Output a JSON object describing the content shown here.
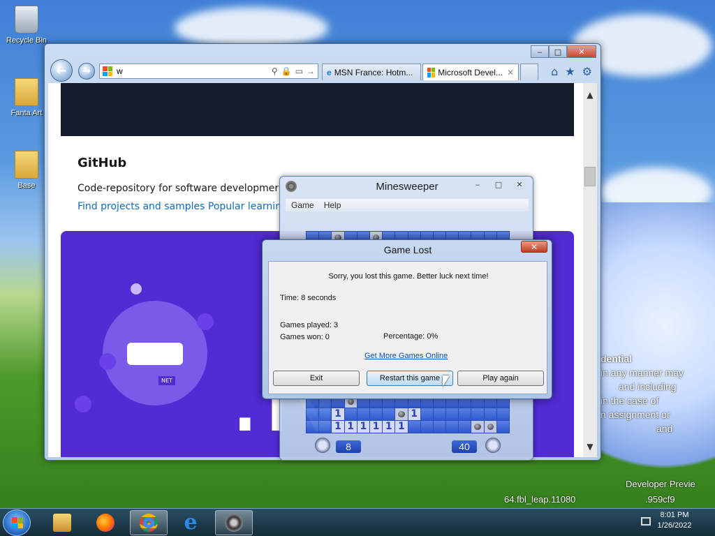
{
  "desktop": {
    "icons": [
      {
        "label": "Recycle Bin"
      },
      {
        "label": "Fanta Art"
      },
      {
        "label": "Base"
      }
    ],
    "wallpaper_text": {
      "line1": "dential",
      "line2": "in any manner may",
      "line3": "and including",
      "line4": "in the case of",
      "line5": "n assignment or",
      "line6": "and",
      "build_line1": "Developer Previe",
      "build_line2": "64.fbl_leap.11080",
      "build_line3": ".959cf9"
    }
  },
  "browser": {
    "address": "w",
    "tabs": [
      {
        "label": "MSN France: Hotm..."
      },
      {
        "label": "Microsoft Devel..."
      }
    ],
    "page": {
      "section_title": "GitHub",
      "description": "Code-repository for software developmer",
      "link": "Find projects and samples Popular learnin",
      "net_text": ".N",
      "robot_badge": "NET"
    }
  },
  "minesweeper": {
    "title": "Minesweeper",
    "menu": [
      "Game",
      "Help"
    ],
    "time_counter": "8",
    "mine_counter": "40"
  },
  "dialog": {
    "title": "Game Lost",
    "message": "Sorry, you lost this game. Better luck next time!",
    "time": "Time: 8 seconds",
    "games_played": "Games played: 3",
    "games_won": "Games won: 0",
    "percentage": "Percentage: 0%",
    "more_games_link": "Get More Games Online",
    "buttons": {
      "exit": "Exit",
      "restart": "Restart this game",
      "play_again": "Play again"
    }
  },
  "taskbar": {
    "time": "8:01 PM",
    "date": "1/26/2022"
  },
  "colors": {
    "purple": "#512bd4",
    "link": "#0f6cbd",
    "dark_banner": "#141c2c"
  }
}
